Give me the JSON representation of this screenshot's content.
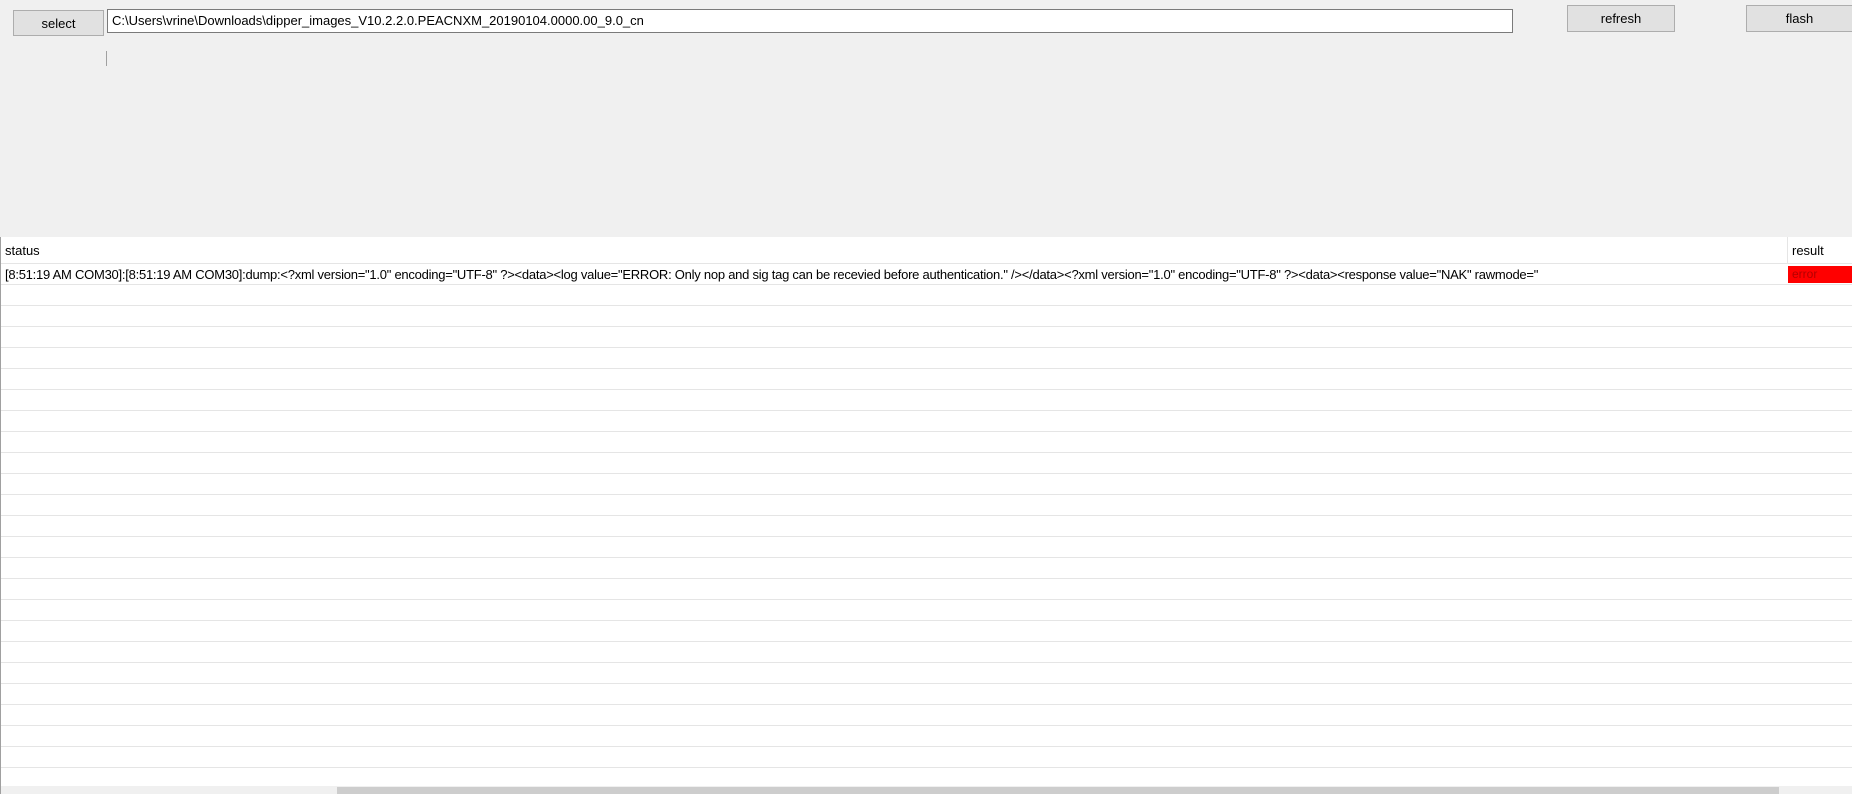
{
  "toolbar": {
    "select_label": "select",
    "refresh_label": "refresh",
    "flash_label": "flash"
  },
  "path_field": {
    "value": "C:\\Users\\vrine\\Downloads\\dipper_images_V10.2.2.0.PEACNXM_20190104.0000.00_9.0_cn"
  },
  "grid": {
    "columns": {
      "status": "status",
      "result": "result"
    },
    "rows": [
      {
        "status": "[8:51:19 AM  COM30]:[8:51:19 AM  COM30]:dump:<?xml version=\"1.0\" encoding=\"UTF-8\" ?><data><log value=\"ERROR: Only nop and sig tag can be recevied before authentication.\" /></data><?xml version=\"1.0\" encoding=\"UTF-8\" ?><data><response value=\"NAK\" rawmode=\"",
        "result": "error"
      }
    ],
    "empty_row_count": 23
  },
  "colors": {
    "error_bg": "#ff0000",
    "background": "#f0f0f0"
  }
}
